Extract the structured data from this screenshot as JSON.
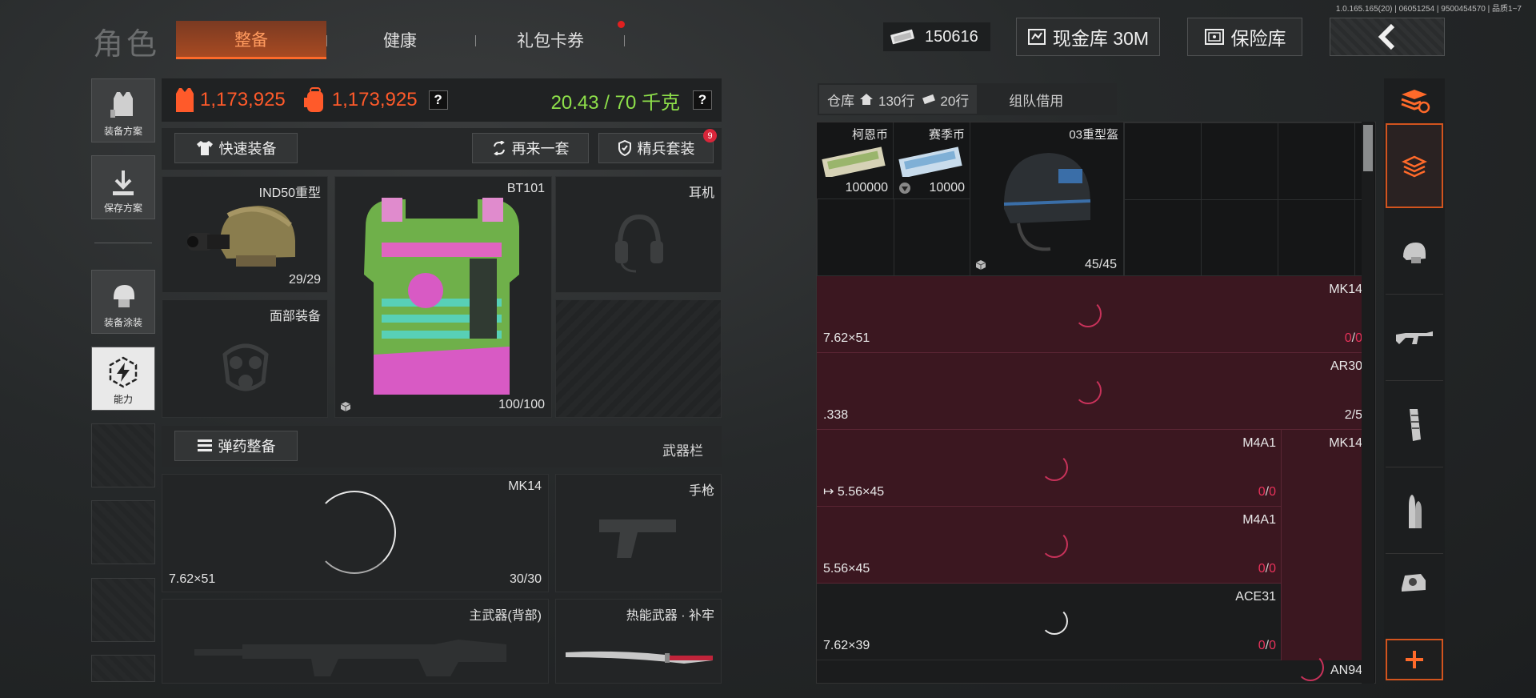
{
  "version": "1.0.165.165(20) | 06051254 | 9500454570 | 品质1~7",
  "header": {
    "title": "角色",
    "tabs": [
      {
        "label": "整备",
        "active": true
      },
      {
        "label": "健康",
        "active": false
      },
      {
        "label": "礼包卡券",
        "active": false,
        "has_notification": true
      }
    ],
    "cash_amount": "150616",
    "cash_vault_label": "现金库 30M",
    "safe_label": "保险库"
  },
  "sidebar": {
    "items": [
      {
        "label": "装备方案",
        "icon": "vest-loadout-icon"
      },
      {
        "label": "保存方案",
        "icon": "save-download-icon"
      },
      {
        "label": "装备涂装",
        "icon": "helmet-paint-icon"
      },
      {
        "label": "能力",
        "icon": "lightning-hex-icon"
      }
    ]
  },
  "stats": {
    "value_armor": "1,173,925",
    "value_bag": "1,173,925",
    "help1": "?",
    "weight": "20.43 / 70 千克",
    "help2": "?"
  },
  "actions": {
    "quick_equip": "快速装备",
    "another_set": "再来一套",
    "elite_set": "精兵套装",
    "elite_badge": "9",
    "ammo_equip": "弹药整备",
    "weapon_bar": "武器栏"
  },
  "slots": {
    "helmet": {
      "name": "IND50重型",
      "durability": "29/29"
    },
    "armor": {
      "name": "BT101",
      "durability": "100/100"
    },
    "headset": {
      "name": "耳机"
    },
    "face": {
      "name": "面部装备"
    },
    "secondary_weapon": {
      "name": "MK14",
      "caliber": "7.62×51",
      "ammo": "30/30"
    },
    "pistol": {
      "name": "手枪"
    },
    "primary_back": {
      "name": "主武器(背部)"
    },
    "melee": {
      "name": "热能武器 · 补牢"
    }
  },
  "warehouse": {
    "tab_label": "仓库",
    "rows": "130行",
    "pieces": "20行",
    "team_borrow": "组队借用",
    "items": [
      {
        "name": "柯恩币",
        "count": "100000"
      },
      {
        "name": "赛季币",
        "count": "10000"
      },
      {
        "name": "03重型盔",
        "count": "45/45"
      }
    ],
    "mags": [
      {
        "name": "MK14",
        "caliber": "7.62×51",
        "count_a": "0",
        "count_b": "0"
      },
      {
        "name": "AR30",
        "caliber": ".338",
        "count": "2/5"
      },
      {
        "name": "M4A1",
        "side": "MK14",
        "caliber": "5.56×45",
        "count_a": "0",
        "count_b": "0",
        "arrow": true
      },
      {
        "name": "M4A1",
        "caliber": "5.56×45",
        "count_a": "0",
        "count_b": "0"
      },
      {
        "name": "ACE31",
        "caliber": "7.62×39",
        "count_a": "0",
        "count_b": "0"
      },
      {
        "name": "AN94"
      }
    ]
  },
  "rail": {
    "icons": [
      "stack-sort-icon",
      "layers-icon",
      "helmet-icon",
      "rifle-icon",
      "magazine-icon",
      "bullet-icon",
      "scope-icon",
      "plus-icon"
    ]
  },
  "colors": {
    "accent": "#ff6a2a",
    "value_orange": "#ff5a2a",
    "weight_green": "#8ee04a",
    "mag_bg": "#3b1720",
    "mag_red": "#e8325a"
  }
}
